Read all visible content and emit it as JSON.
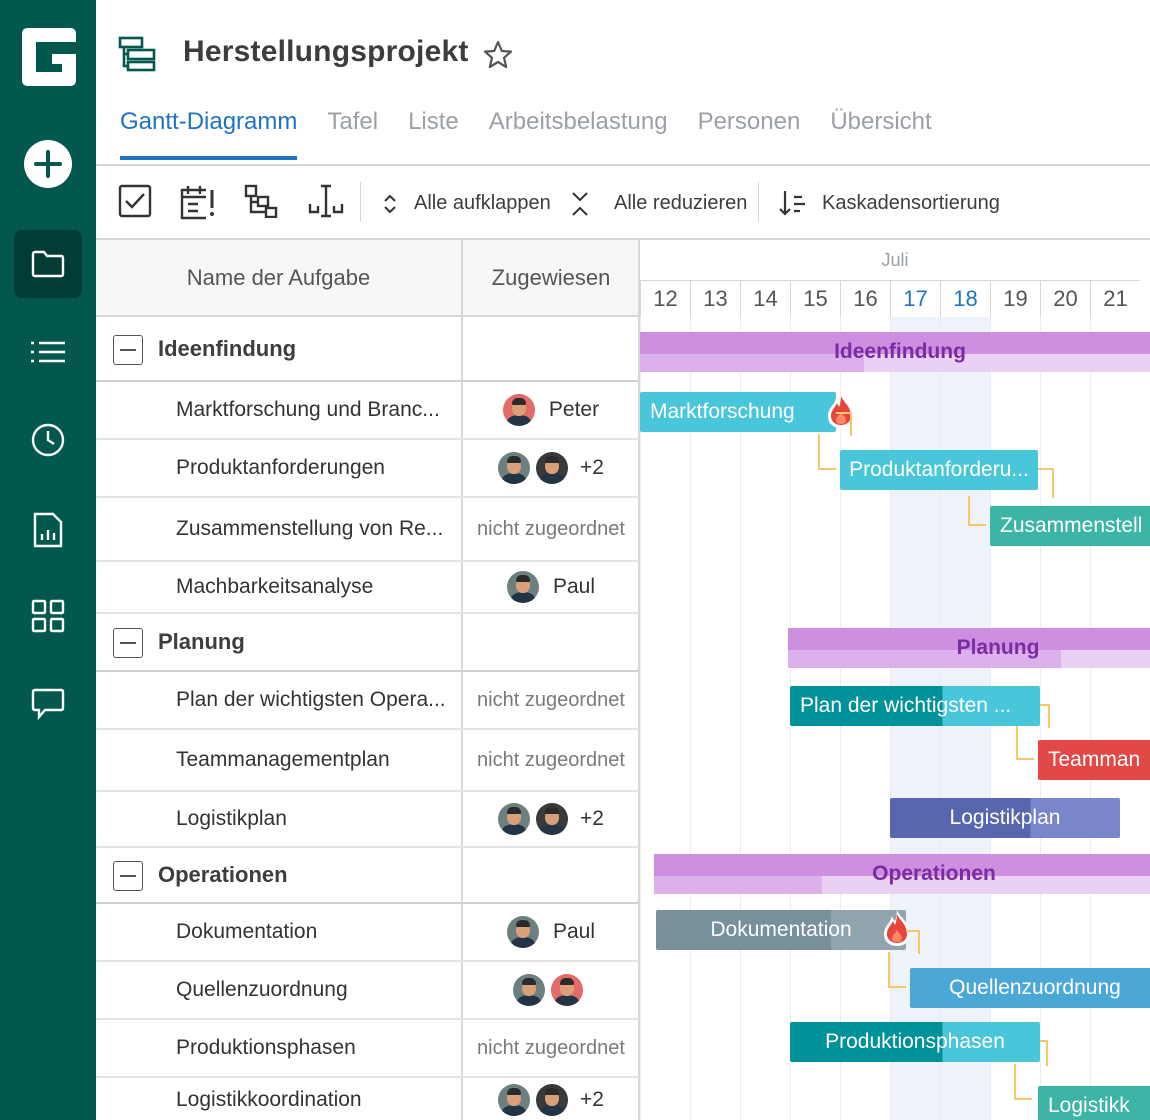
{
  "project": {
    "title": "Herstellungsprojekt"
  },
  "tabs": [
    {
      "label": "Gantt-Diagramm",
      "active": true
    },
    {
      "label": "Tafel"
    },
    {
      "label": "Liste"
    },
    {
      "label": "Arbeitsbelastung"
    },
    {
      "label": "Personen"
    },
    {
      "label": "Übersicht"
    }
  ],
  "toolbar": {
    "expand_all": "Alle aufklappen",
    "collapse_all": "Alle reduzieren",
    "cascade_sort": "Kaskadensortierung"
  },
  "grid": {
    "col_name": "Name der Aufgabe",
    "col_assigned": "Zugewiesen",
    "unassigned": "nicht zugeordnet"
  },
  "timeline": {
    "month": "Juli",
    "days": [
      "12",
      "13",
      "14",
      "15",
      "16",
      "17",
      "18",
      "19",
      "20",
      "21"
    ],
    "today_days": [
      "17",
      "18"
    ]
  },
  "rows": [
    {
      "type": "group",
      "name": "Ideenfindung"
    },
    {
      "type": "task",
      "name": "Marktforschung und Branc...",
      "assignee": "Peter",
      "avatars": [
        "peter"
      ],
      "extra": ""
    },
    {
      "type": "task",
      "name": "Produktanforderungen",
      "assignee": "",
      "avatars": [
        "gray",
        "dark"
      ],
      "extra": "+2"
    },
    {
      "type": "task",
      "name": "Zusammenstellung von Re...",
      "assignee": "nicht zugeordnet",
      "avatars": [],
      "extra": ""
    },
    {
      "type": "task",
      "name": "Machbarkeitsanalyse",
      "assignee": "Paul",
      "avatars": [
        "gray"
      ],
      "extra": ""
    },
    {
      "type": "group",
      "name": "Planung"
    },
    {
      "type": "task",
      "name": "Plan der wichtigsten Opera...",
      "assignee": "nicht zugeordnet",
      "avatars": [],
      "extra": ""
    },
    {
      "type": "task",
      "name": "Teammanagementplan",
      "assignee": "nicht zugeordnet",
      "avatars": [],
      "extra": ""
    },
    {
      "type": "task",
      "name": "Logistikplan",
      "assignee": "",
      "avatars": [
        "gray",
        "dark"
      ],
      "extra": "+2"
    },
    {
      "type": "group",
      "name": "Operationen"
    },
    {
      "type": "task",
      "name": "Dokumentation",
      "assignee": "Paul",
      "avatars": [
        "gray"
      ],
      "extra": ""
    },
    {
      "type": "task",
      "name": "Quellenzuordnung",
      "assignee": "",
      "avatars": [
        "gray",
        "peter"
      ],
      "extra": ""
    },
    {
      "type": "task",
      "name": "Produktionsphasen",
      "assignee": "nicht zugeordnet",
      "avatars": [],
      "extra": ""
    },
    {
      "type": "task",
      "name": "Logistikkoordination",
      "assignee": "",
      "avatars": [
        "gray",
        "dark"
      ],
      "extra": "+2"
    }
  ],
  "bars": {
    "ideenfindung": "Ideenfindung",
    "marktforschung": "Marktforschung",
    "produktanforderungen": "Produktanforderu...",
    "zusammenstellung": "Zusammenstell",
    "planung": "Planung",
    "plan_operationen": "Plan der wichtigsten ...",
    "teammanagement": "Teamman",
    "logistikplan": "Logistikplan",
    "operationen": "Operationen",
    "dokumentation": "Dokumentation",
    "quellenzuordnung": "Quellenzuordnung",
    "produktionsphasen": "Produktionsphasen",
    "logistikkoordination": "Logistikk"
  },
  "colors": {
    "sidebar": "#02584c",
    "accent": "#1f73c4",
    "group_bar": "#cf8fe0",
    "bar_cyan": "#4ac6da",
    "bar_teal": "#3db5a6",
    "bar_dark_teal": "#00919a",
    "bar_red": "#e24848",
    "bar_indigo": "#5766ae",
    "bar_slate": "#78909c",
    "bar_blue": "#4aa7d6",
    "dependency": "#f6c76e"
  },
  "icons": {
    "sidebar": [
      "add-icon",
      "folder-icon",
      "list-icon",
      "clock-icon",
      "report-icon",
      "apps-icon",
      "chat-icon"
    ],
    "fire": "fire-icon"
  }
}
